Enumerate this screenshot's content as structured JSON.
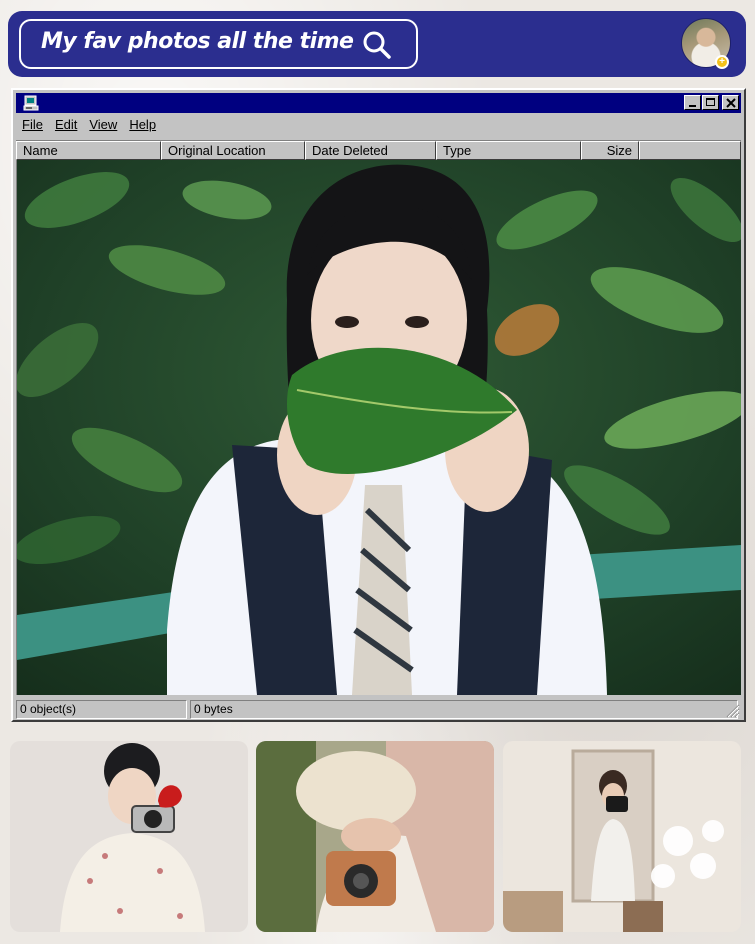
{
  "header": {
    "search_text": "My fav photos all the time",
    "search_icon": "search-icon",
    "avatar_icon": "user-avatar",
    "badge_icon": "plus-badge-icon"
  },
  "window": {
    "title_icon": "computer-icon",
    "controls": [
      "minimize",
      "maximize",
      "close"
    ],
    "menu": [
      "File",
      "Edit",
      "View",
      "Help"
    ],
    "columns": [
      "Name",
      "Original Location",
      "Date Deleted",
      "Type",
      "Size"
    ],
    "status": {
      "objects": "0 object(s)",
      "bytes": "0 bytes"
    }
  },
  "colors": {
    "header_bg": "#2b2e8f",
    "titlebar_bg": "#000080",
    "window_face": "#c3c3c3",
    "page_bg": "#ece8e3"
  }
}
